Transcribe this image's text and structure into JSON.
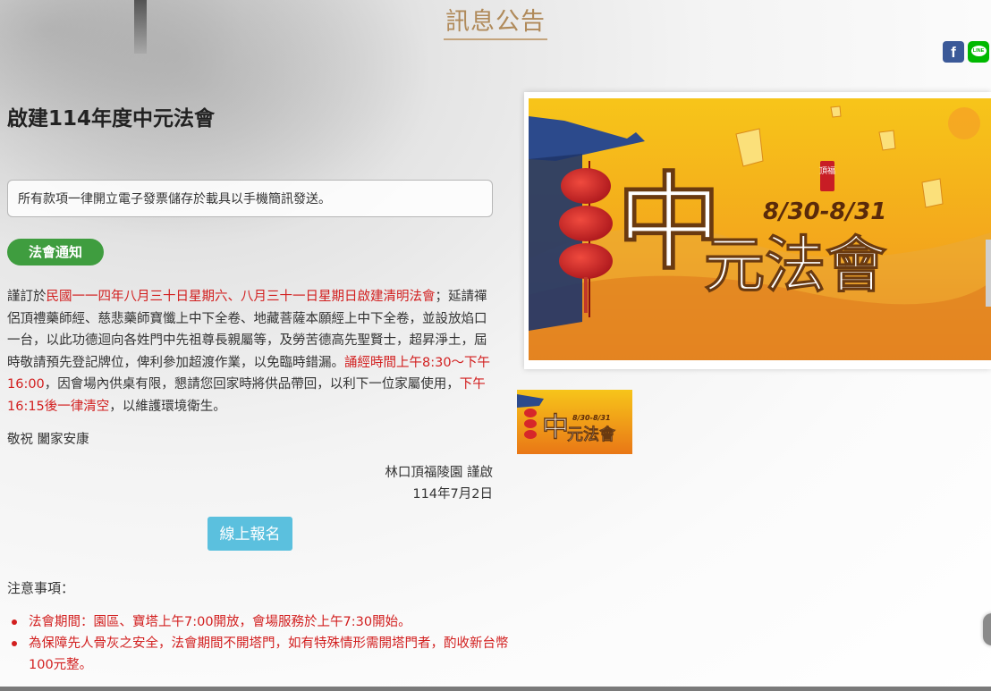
{
  "page": {
    "title": "訊息公告"
  },
  "share": {
    "facebook_glyph": "f",
    "line_glyph": "LINE"
  },
  "article": {
    "title": "啟建114年度中元法會",
    "notice": "所有款項一律開立電子發票儲存於載具以手機簡訊發送。",
    "badge": "法會通知",
    "p1_a": "謹訂於",
    "p1_b": "民國一一四年八月三十日星期六、八月三十一日星期日啟建清明法會",
    "p1_c": "；延請禪侶頂禮藥師經、慈悲藥師寶懺上中下全卷、地藏菩薩本願經上中下全卷，並設放焰口一台，以此功德迴向各姓門中先祖尊長親屬等，及勞苦德高先聖賢士，超昇淨土，屆時敬請預先登記牌位，俾利參加超渡作業，以免臨時錯漏。",
    "p1_d": "誦經時間上午8:30～下午16:00",
    "p1_e": "，因會場內供桌有限，懇請您回家時將供品帶回，以利下一位家屬使用，",
    "p1_f": "下午16:15後一律清空",
    "p1_g": "，以維護環境衛生。",
    "closing": "敬祝 闔家安康",
    "signer": "林口頂福陵園 謹啟",
    "date": "114年7月2日",
    "signup_label": "線上報名"
  },
  "notes": {
    "title": "注意事項：",
    "items": [
      "法會期間：園區、寶塔上午7:00開放，會場服務於上午7:30開始。",
      "為保障先人骨灰之安全，法會期間不開塔門，如有特殊情形需開塔門者，酌收新台幣100元整。"
    ]
  },
  "banner": {
    "dates": "8/30-8/31",
    "title_big": "中",
    "title_rest": "元法會",
    "seal": "頂福",
    "thumb_dates": "8/30-8/31",
    "colors": {
      "sky_top": "#f7c51a",
      "sky_bottom": "#e97716",
      "lantern": "#d6262a",
      "roof": "#2c4a8c"
    }
  },
  "icons": [
    "facebook-icon",
    "line-icon",
    "red-lantern-icon",
    "sky-lantern-icon"
  ]
}
